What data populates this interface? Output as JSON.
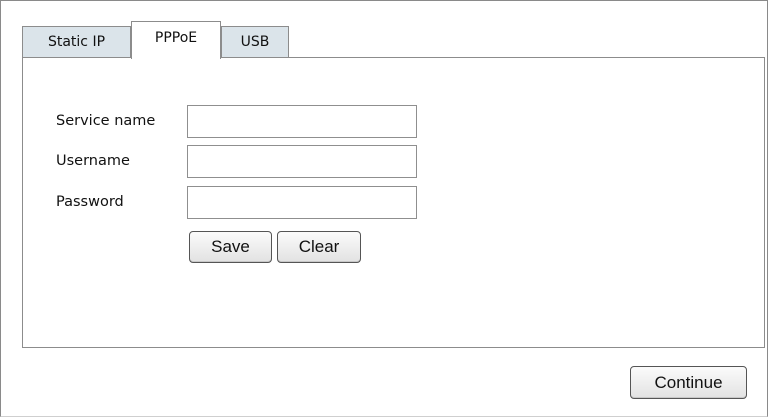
{
  "tabs": [
    {
      "label": "Static IP",
      "active": false
    },
    {
      "label": "PPPoE",
      "active": true
    },
    {
      "label": "USB",
      "active": false
    }
  ],
  "form": {
    "service_name": {
      "label": "Service name",
      "value": ""
    },
    "username": {
      "label": "Username",
      "value": ""
    },
    "password": {
      "label": "Password",
      "value": ""
    }
  },
  "buttons": {
    "save": "Save",
    "clear": "Clear",
    "continue": "Continue"
  }
}
